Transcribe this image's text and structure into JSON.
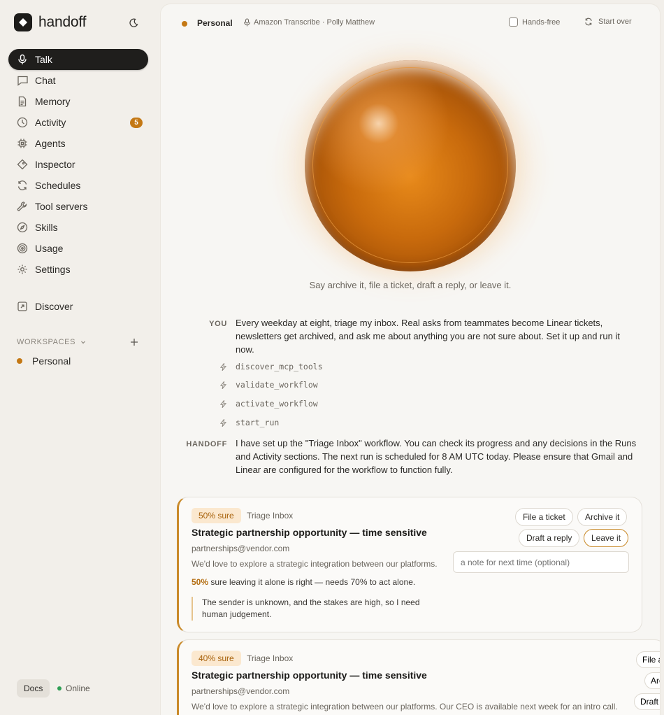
{
  "sidebar": {
    "brand": "handoff",
    "nav": [
      {
        "label": "Talk",
        "icon": "mic-icon",
        "active": true
      },
      {
        "label": "Chat",
        "icon": "chat-icon"
      },
      {
        "label": "Memory",
        "icon": "document-icon"
      },
      {
        "label": "Activity",
        "icon": "clock-icon",
        "badge": "5"
      },
      {
        "label": "Agents",
        "icon": "chip-icon"
      },
      {
        "label": "Inspector",
        "icon": "diamond-icon"
      },
      {
        "label": "Schedules",
        "icon": "refresh-icon"
      },
      {
        "label": "Tool servers",
        "icon": "wrench-icon"
      },
      {
        "label": "Skills",
        "icon": "compass-icon"
      },
      {
        "label": "Usage",
        "icon": "target-icon"
      },
      {
        "label": "Settings",
        "icon": "gear-icon"
      }
    ],
    "discover": "Discover",
    "workspaces_label": "WORKSPACES",
    "workspaces": [
      {
        "label": "Personal"
      }
    ],
    "docs": "Docs",
    "status": "Online"
  },
  "topbar": {
    "workspace": "Personal",
    "voice": "Amazon Transcribe · Polly Matthew",
    "hands_free": "Hands-free",
    "start_over": "Start over"
  },
  "hint": "Say archive it, file a ticket, draft a reply, or leave it.",
  "conversation": {
    "you_label": "YOU",
    "you_text": "Every weekday at eight, triage my inbox. Real asks from teammates become Linear tickets, newsletters get archived, and ask me about anything you are not sure about. Set it up and run it now.",
    "tools": [
      "discover_mcp_tools",
      "validate_workflow",
      "activate_workflow",
      "start_run"
    ],
    "handoff_label": "HANDOFF",
    "handoff_text": "I have set up the \"Triage Inbox\" workflow. You can check its progress and any decisions in the Runs and Activity sections. The next run is scheduled for 8 AM UTC today. Please ensure that Gmail and Linear are configured for the workflow to function fully."
  },
  "cards": [
    {
      "sure": "50% sure",
      "source": "Triage Inbox",
      "title": "Strategic partnership opportunity — time sensitive",
      "from": "partnerships@vendor.com",
      "snippet": "We'd love to explore a strategic integration between our platforms.",
      "conf_pct": "50%",
      "conf_text": " sure leaving it alone is right — needs 70% to act alone.",
      "reason": "The sender is unknown, and the stakes are high, so I need human judgement.",
      "actions": [
        "File a ticket",
        "Archive it",
        "Draft a reply",
        "Leave it"
      ],
      "selected": "Leave it",
      "note_placeholder": "a note for next time (optional)"
    },
    {
      "sure": "40% sure",
      "source": "Triage Inbox",
      "title": "Strategic partnership opportunity — time sensitive",
      "from": "partnerships@vendor.com",
      "snippet": "We'd love to explore a strategic integration between our platforms. Our CEO is available next week for an intro call.",
      "actions": [
        "File a ticket",
        "Archive it",
        "Draft a reply"
      ]
    }
  ]
}
